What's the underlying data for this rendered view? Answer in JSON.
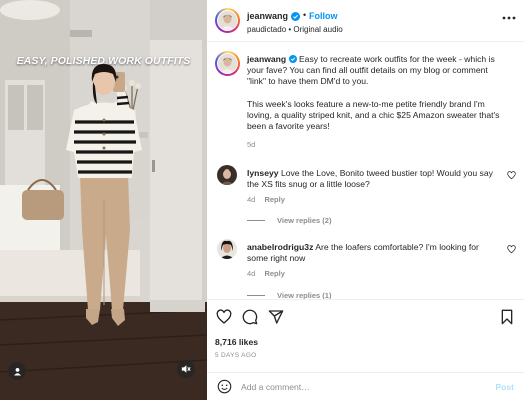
{
  "media": {
    "caption": "EASY, POLISHED WORK OUTFITS"
  },
  "header": {
    "username": "jeanwang",
    "dot": "•",
    "follow_label": "Follow",
    "audio": "paudictado • Original audio"
  },
  "caption": {
    "username": "jeanwang",
    "para1": "Easy to recreate work outfits for the week - which is your fave? You can find all outfit details on my blog or comment \"link\" to have them DM'd to you.",
    "para2": "This week's looks feature a new-to-me petite friendly brand I'm loving, a quality striped knit, and a chic $25 Amazon sweater that's been a favorite years!",
    "time": "5d"
  },
  "comments": [
    {
      "username": "lynseyy",
      "text": "Love the Love, Bonito tweed bustier top! Would you say the XS fits snug or a little loose?",
      "time": "4d",
      "reply_label": "Reply",
      "view_replies": "View replies (2)"
    },
    {
      "username": "anabelrodrigu3z",
      "text": "Are the loafers comfortable? I'm looking for some right now",
      "time": "4d",
      "reply_label": "Reply",
      "view_replies": "View replies (1)"
    }
  ],
  "actions": {
    "likes": "8,716 likes",
    "posted": "5 DAYS AGO"
  },
  "add_comment": {
    "placeholder": "Add a comment…",
    "post_label": "Post"
  },
  "colors": {
    "link_blue": "#0095f6",
    "post_disabled": "#b2dffc",
    "muted_text": "#8e8e8e"
  }
}
